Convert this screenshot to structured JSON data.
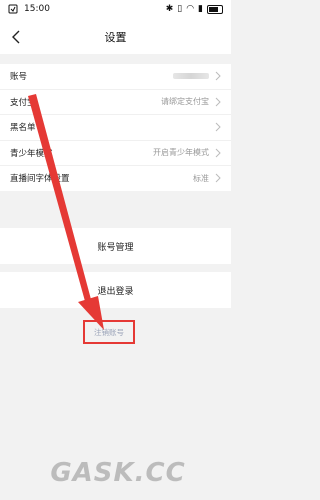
{
  "statusbar": {
    "time": "15:00"
  },
  "nav": {
    "title": "设置"
  },
  "settings": {
    "rows": [
      {
        "label": "账号",
        "value": ""
      },
      {
        "label": "支付宝",
        "value": "请绑定支付宝"
      },
      {
        "label": "黑名单",
        "value": ""
      },
      {
        "label": "青少年模式",
        "value": "开启青少年模式"
      },
      {
        "label": "直播间字体设置",
        "value": "标准"
      }
    ]
  },
  "buttons": {
    "account_manage": "账号管理",
    "logout": "退出登录",
    "deactivate": "注销账号"
  },
  "watermark": {
    "text": "GASK.CC"
  },
  "colors": {
    "highlight": "#e53935",
    "background": "#f2f2f2"
  }
}
